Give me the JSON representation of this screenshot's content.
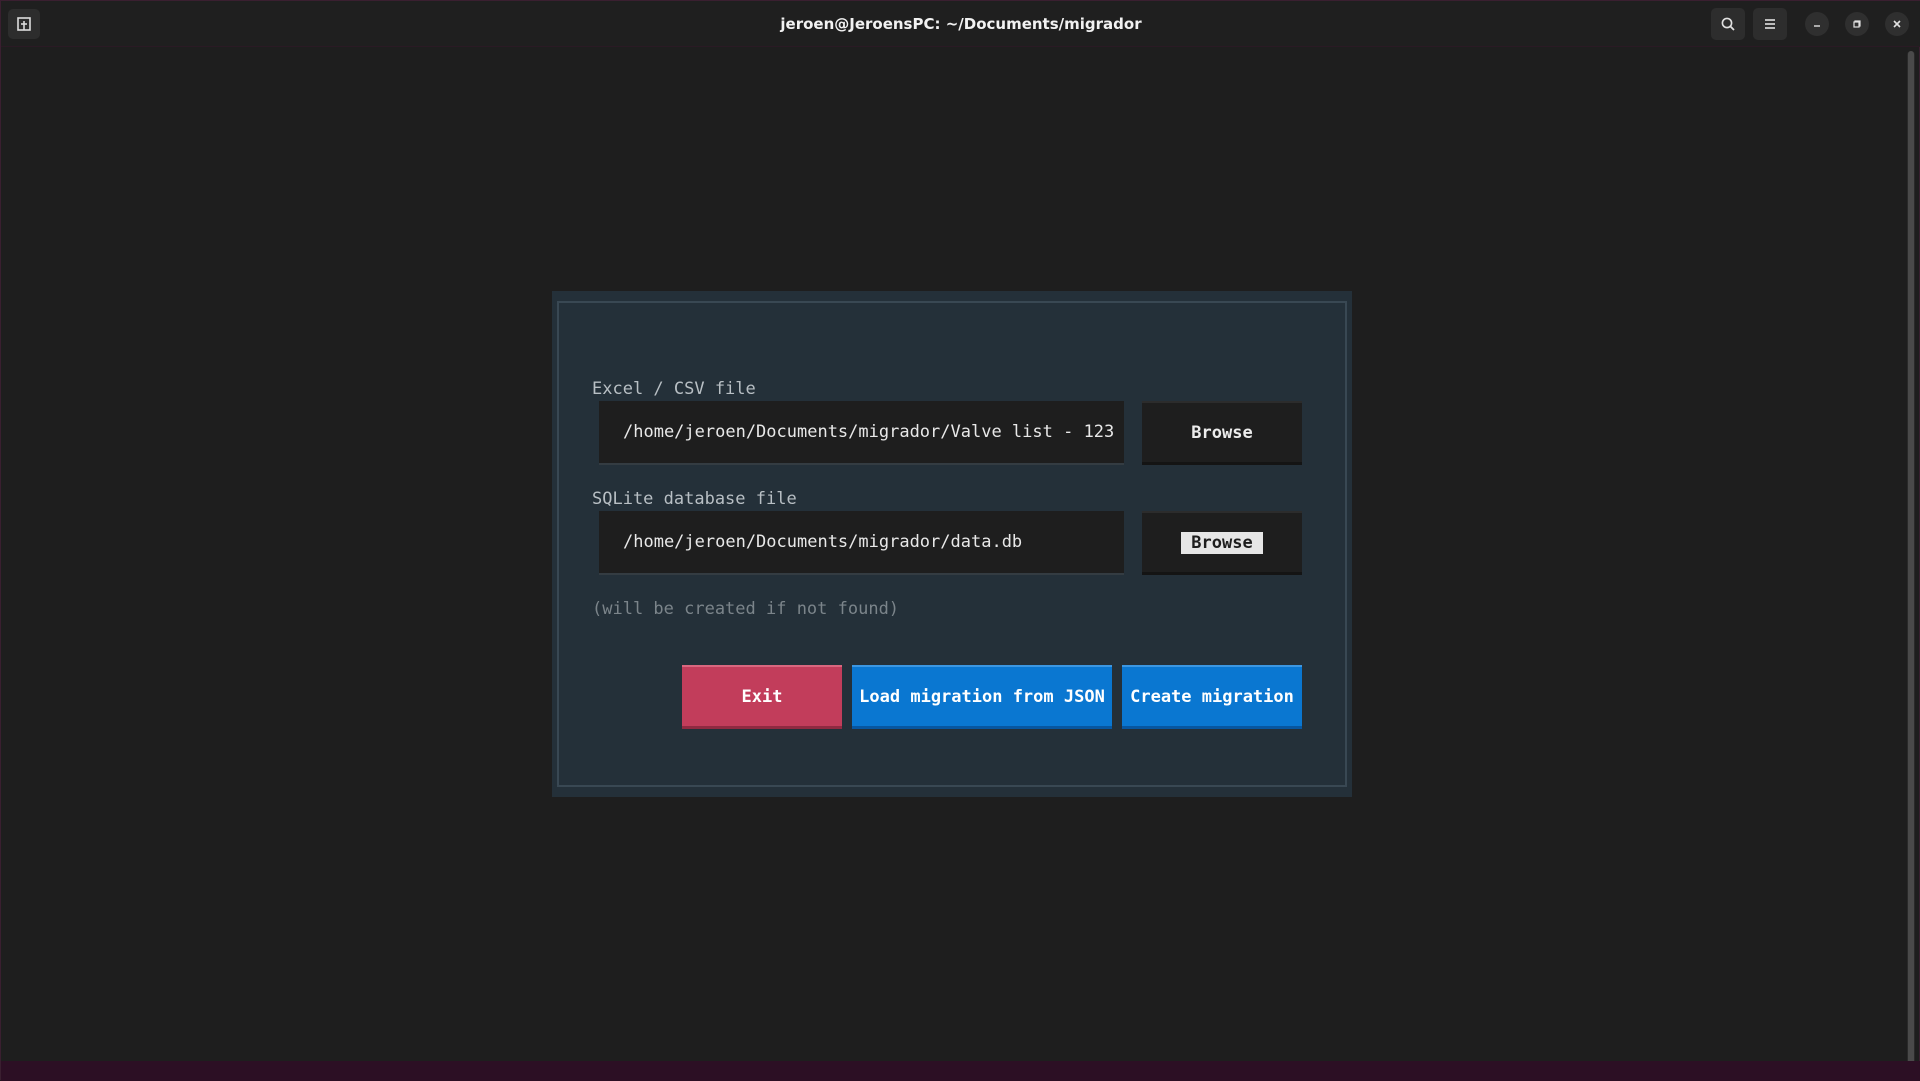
{
  "window": {
    "title": "jeroen@JeroensPC: ~/Documents/migrador",
    "icons": {
      "new_tab": "new-tab-icon",
      "search": "search-icon",
      "menu": "hamburger-menu-icon",
      "minimize": "minimize-icon",
      "maximize": "restore-icon",
      "close": "close-icon"
    }
  },
  "form": {
    "excel_label": "Excel / CSV file",
    "excel_value": "/home/jeroen/Documents/migrador/Valve list - 123",
    "excel_browse": "Browse",
    "sqlite_label": "SQLite database file",
    "sqlite_value": "/home/jeroen/Documents/migrador/data.db",
    "sqlite_browse": "Browse",
    "hint": "(will be created if not found)"
  },
  "actions": {
    "exit": "Exit",
    "load_json": "Load migration from JSON",
    "create": "Create migration"
  },
  "colors": {
    "exit": "#c23d5b",
    "primary": "#0a77d1",
    "dialog_bg": "#243039",
    "terminal_bg": "#1e1e1e"
  }
}
